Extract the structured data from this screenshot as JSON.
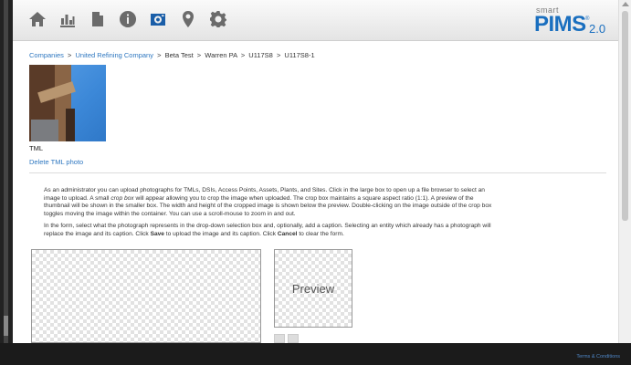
{
  "nav": {
    "items": [
      {
        "icon": "home-icon",
        "name": "nav-home"
      },
      {
        "icon": "bar-chart-icon",
        "name": "nav-reports"
      },
      {
        "icon": "document-icon",
        "name": "nav-documents"
      },
      {
        "icon": "info-icon",
        "name": "nav-info"
      },
      {
        "icon": "camera-icon",
        "name": "nav-photos",
        "active": true
      },
      {
        "icon": "map-pin-icon",
        "name": "nav-map"
      },
      {
        "icon": "gear-icon",
        "name": "nav-settings"
      }
    ],
    "active_color": "#1a5ea8",
    "inactive_color": "#6b6b6b"
  },
  "logo": {
    "smart": "smart",
    "pims": "PIMS",
    "registered": "®",
    "version": "2.0",
    "color": "#1a6fbf"
  },
  "breadcrumb": {
    "companies": "Companies",
    "company": "United Refining Company",
    "sep": ">",
    "test": "Beta Test",
    "site": "Warren PA",
    "unit": "U117S8",
    "item": "U117S8-1"
  },
  "photo": {
    "label": "TML",
    "delete_label": "Delete TML photo"
  },
  "instructions": {
    "p1_a": "As an administrator you can upload photographs for TMLs, DSIs, Access Points, Assets, Plants, and Sites. Click in the large box to open up a file browser to select an image to upload. A small ",
    "p1_em": "crop box",
    "p1_b": " will appear allowing you to crop the image when uploaded. The crop box maintains a square aspect ratio (1:1). A preview of the thumbnail will be shown in the smaller box. The width and height of the cropped image is shown below the preview. Double-clicking on the image outside of the crop box toggles moving the image within the container. You can use a scroll-mouse to zoom in and out.",
    "p2_a": "In the form, select what the photograph represents in the drop-down selection box and, optionally, add a caption. Selecting an entity which already has a photograph will replace the image and its caption. Click ",
    "p2_save": "Save",
    "p2_b": " to upload the image and its caption. Click ",
    "p2_cancel": "Cancel",
    "p2_c": " to clear the form."
  },
  "preview": {
    "label": "Preview"
  },
  "footer": {
    "terms": "Terms & Conditions"
  }
}
